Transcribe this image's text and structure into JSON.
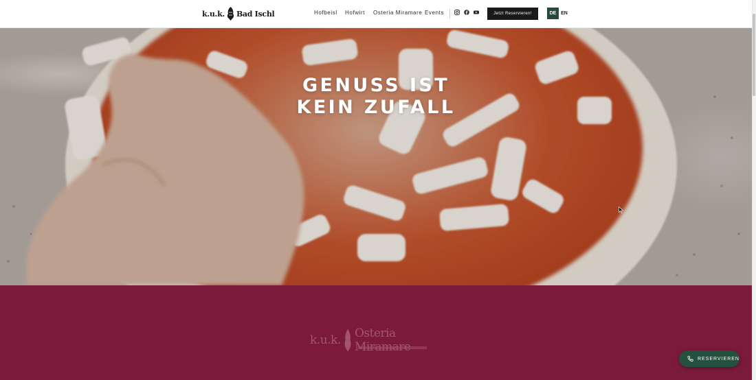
{
  "header": {
    "logo": {
      "prefix": "k.u.k.",
      "name": "Bad Ischl"
    },
    "nav": [
      {
        "label": "Hofbeisl"
      },
      {
        "label": "Hofwirt"
      },
      {
        "label": "Osteria Miramare"
      },
      {
        "label": "Events"
      }
    ],
    "socials": [
      "instagram-icon",
      "facebook-icon",
      "youtube-icon"
    ],
    "cta_label": "Jetzt Reservieren!",
    "lang": {
      "de": "DE",
      "en": "EN",
      "active": "DE"
    }
  },
  "hero": {
    "title_line1": "GENUSS IST",
    "title_line2": "KEIN ZUFALL"
  },
  "section": {
    "logo_prefix": "k.u.k.",
    "logo_name": "Osteria Miramare"
  },
  "floating": {
    "reserve_label": "RESERVIEREN"
  },
  "colors": {
    "brand_green": "#244a3b",
    "maroon": "#7b1a3b",
    "cta_black": "#1a1a1a"
  }
}
